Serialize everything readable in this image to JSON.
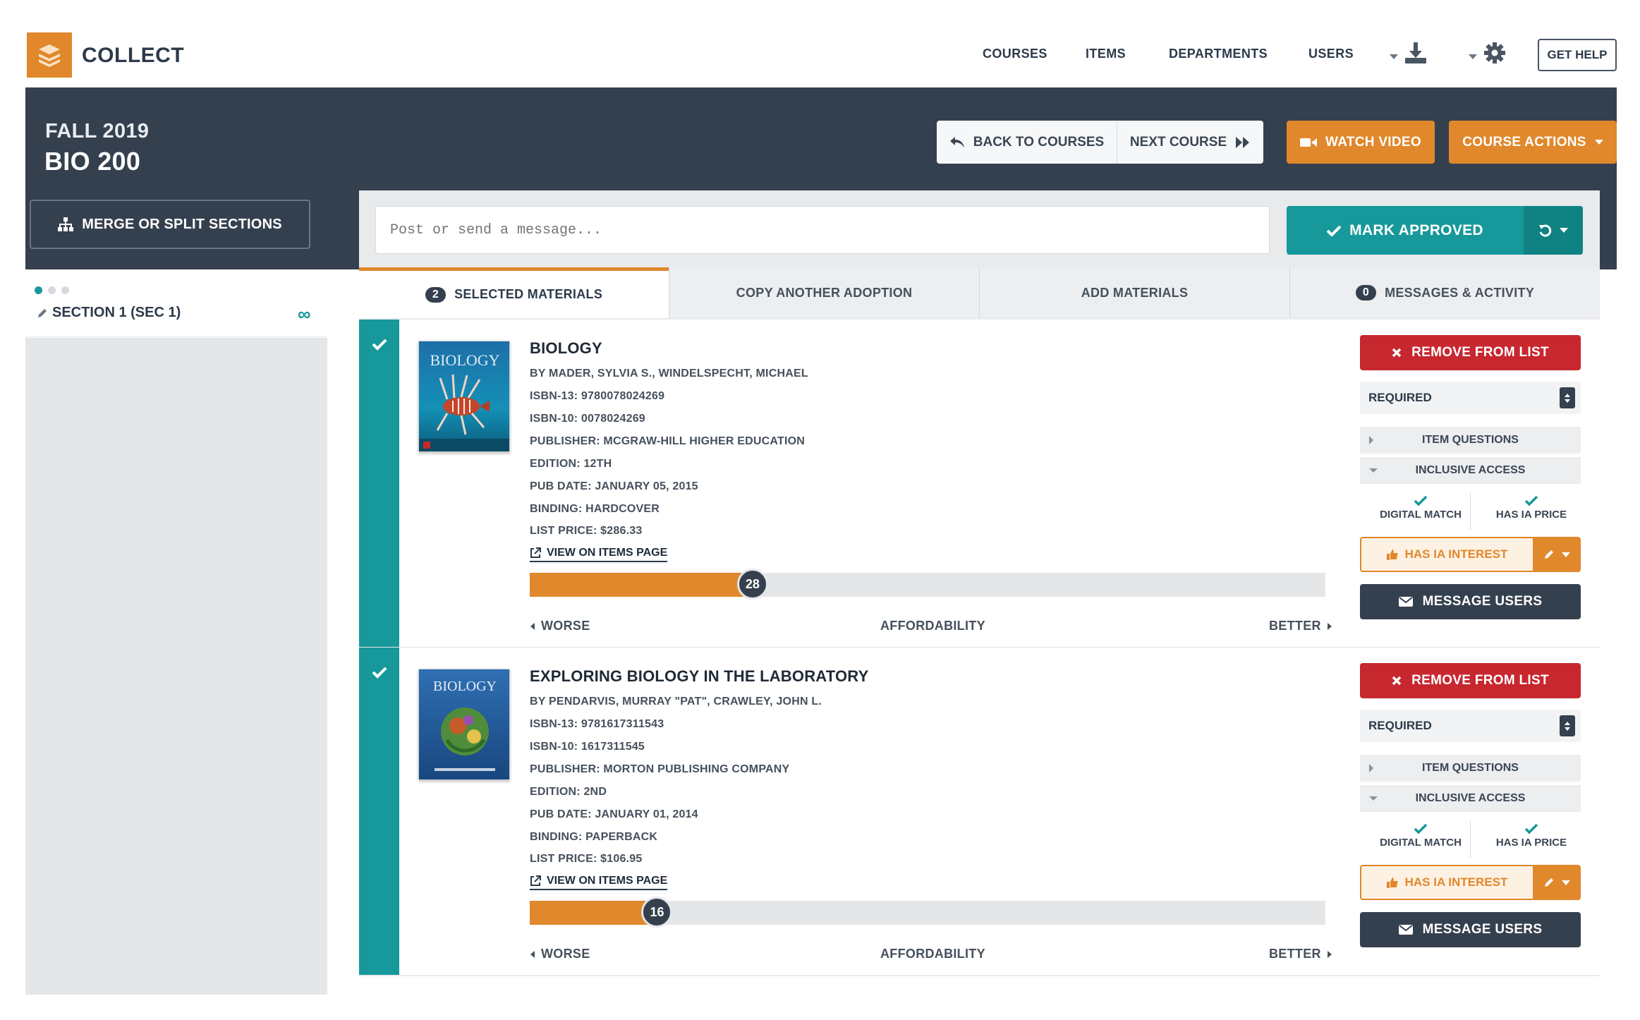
{
  "app": {
    "name": "COLLECT"
  },
  "nav": {
    "items": [
      "COURSES",
      "ITEMS",
      "DEPARTMENTS",
      "USERS"
    ],
    "get_help": "GET HELP"
  },
  "header": {
    "term": "FALL 2019",
    "course": "BIO 200",
    "back_label": "BACK TO COURSES",
    "next_label": "NEXT COURSE",
    "watch_label": "WATCH VIDEO",
    "actions_label": "COURSE ACTIONS",
    "merge_label": "MERGE OR SPLIT SECTIONS"
  },
  "message": {
    "placeholder": "Post or send a message...",
    "approve_label": "MARK APPROVED"
  },
  "tabs": [
    {
      "count": "2",
      "label": "SELECTED MATERIALS"
    },
    {
      "label": "COPY ANOTHER ADOPTION"
    },
    {
      "label": "ADD MATERIALS"
    },
    {
      "count": "0",
      "label": "MESSAGES & ACTIVITY"
    }
  ],
  "sidebar": {
    "section": "SECTION 1 (SEC 1)",
    "symbol": "∞"
  },
  "items": [
    {
      "title": "BIOLOGY",
      "authors": "BY MADER, SYLVIA S., WINDELSPECHT, MICHAEL",
      "isbn13": "ISBN-13: 9780078024269",
      "isbn10": "ISBN-10: 0078024269",
      "publisher": "PUBLISHER: MCGRAW-HILL HIGHER EDUCATION",
      "edition": "EDITION: 12TH",
      "pubdate": "PUB DATE: JANUARY 05, 2015",
      "binding": "BINDING: HARDCOVER",
      "price": "LIST PRICE: $286.33",
      "link": "VIEW ON ITEMS PAGE",
      "cover_text": "BIOLOGY",
      "affordability": 28,
      "affordability_value": "28"
    },
    {
      "title": "EXPLORING BIOLOGY IN THE LABORATORY",
      "authors": "BY PENDARVIS, MURRAY \"PAT\", CRAWLEY, JOHN L.",
      "isbn13": "ISBN-13: 9781617311543",
      "isbn10": "ISBN-10: 1617311545",
      "publisher": "PUBLISHER: MORTON PUBLISHING COMPANY",
      "edition": "EDITION: 2ND",
      "pubdate": "PUB DATE: JANUARY 01, 2014",
      "binding": "BINDING: PAPERBACK",
      "price": "LIST PRICE: $106.95",
      "link": "VIEW ON ITEMS PAGE",
      "cover_text": "BIOLOGY",
      "affordability": 16,
      "affordability_value": "16"
    }
  ],
  "affordability_scale": {
    "worse": "WORSE",
    "label": "AFFORDABILITY",
    "better": "BETTER"
  },
  "actions": {
    "remove": "REMOVE FROM LIST",
    "requirement": "REQUIRED",
    "item_questions": "ITEM QUESTIONS",
    "inclusive_access": "INCLUSIVE ACCESS",
    "digital_match": "DIGITAL MATCH",
    "has_ia_price": "HAS IA PRICE",
    "has_ia_interest": "HAS IA INTEREST",
    "message_users": "MESSAGE USERS"
  },
  "colors": {
    "accent": "#e0882b",
    "teal": "#17989a",
    "dark": "#35404f",
    "danger": "#c7272f"
  }
}
